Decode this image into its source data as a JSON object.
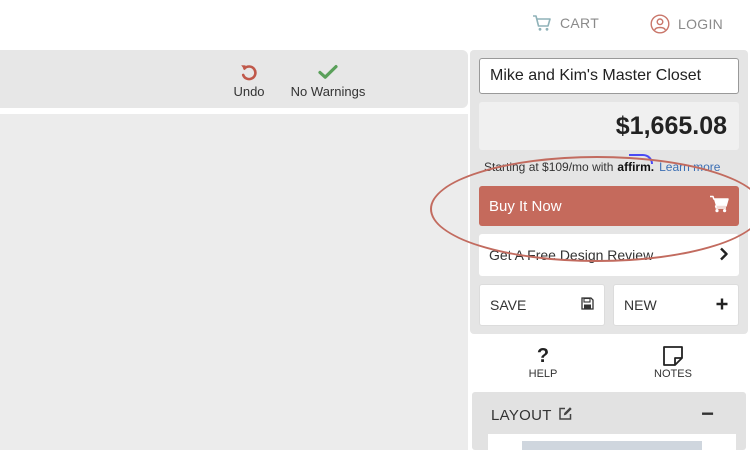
{
  "nav": {
    "cart_label": "CART",
    "login_label": "LOGIN"
  },
  "toolbar": {
    "undo_label": "Undo",
    "warnings_label": "No Warnings"
  },
  "design": {
    "name": "Mike and Kim's Master Closet",
    "price": "$1,665.08"
  },
  "financing": {
    "text": "Starting at $109/mo with",
    "brand": "affirm.",
    "link": "Learn more"
  },
  "actions": {
    "buy_label": "Buy It Now",
    "review_label": "Get A Free Design Review",
    "save_label": "SAVE",
    "new_label": "NEW"
  },
  "utilities": {
    "help_label": "HELP",
    "notes_label": "NOTES"
  },
  "layout": {
    "title": "LAYOUT"
  },
  "colors": {
    "accent": "#c56a5c",
    "nav_text": "#8a8a8a",
    "check_green": "#5aa05a",
    "undo_red": "#c0584a",
    "link_blue": "#3c6fb4"
  },
  "icons": [
    "cart-icon",
    "user-icon",
    "undo-icon",
    "check-icon",
    "shopping-cart-icon",
    "chevron-right-icon",
    "floppy-disk-icon",
    "plus-icon",
    "question-icon",
    "note-icon",
    "edit-icon",
    "minus-icon"
  ]
}
